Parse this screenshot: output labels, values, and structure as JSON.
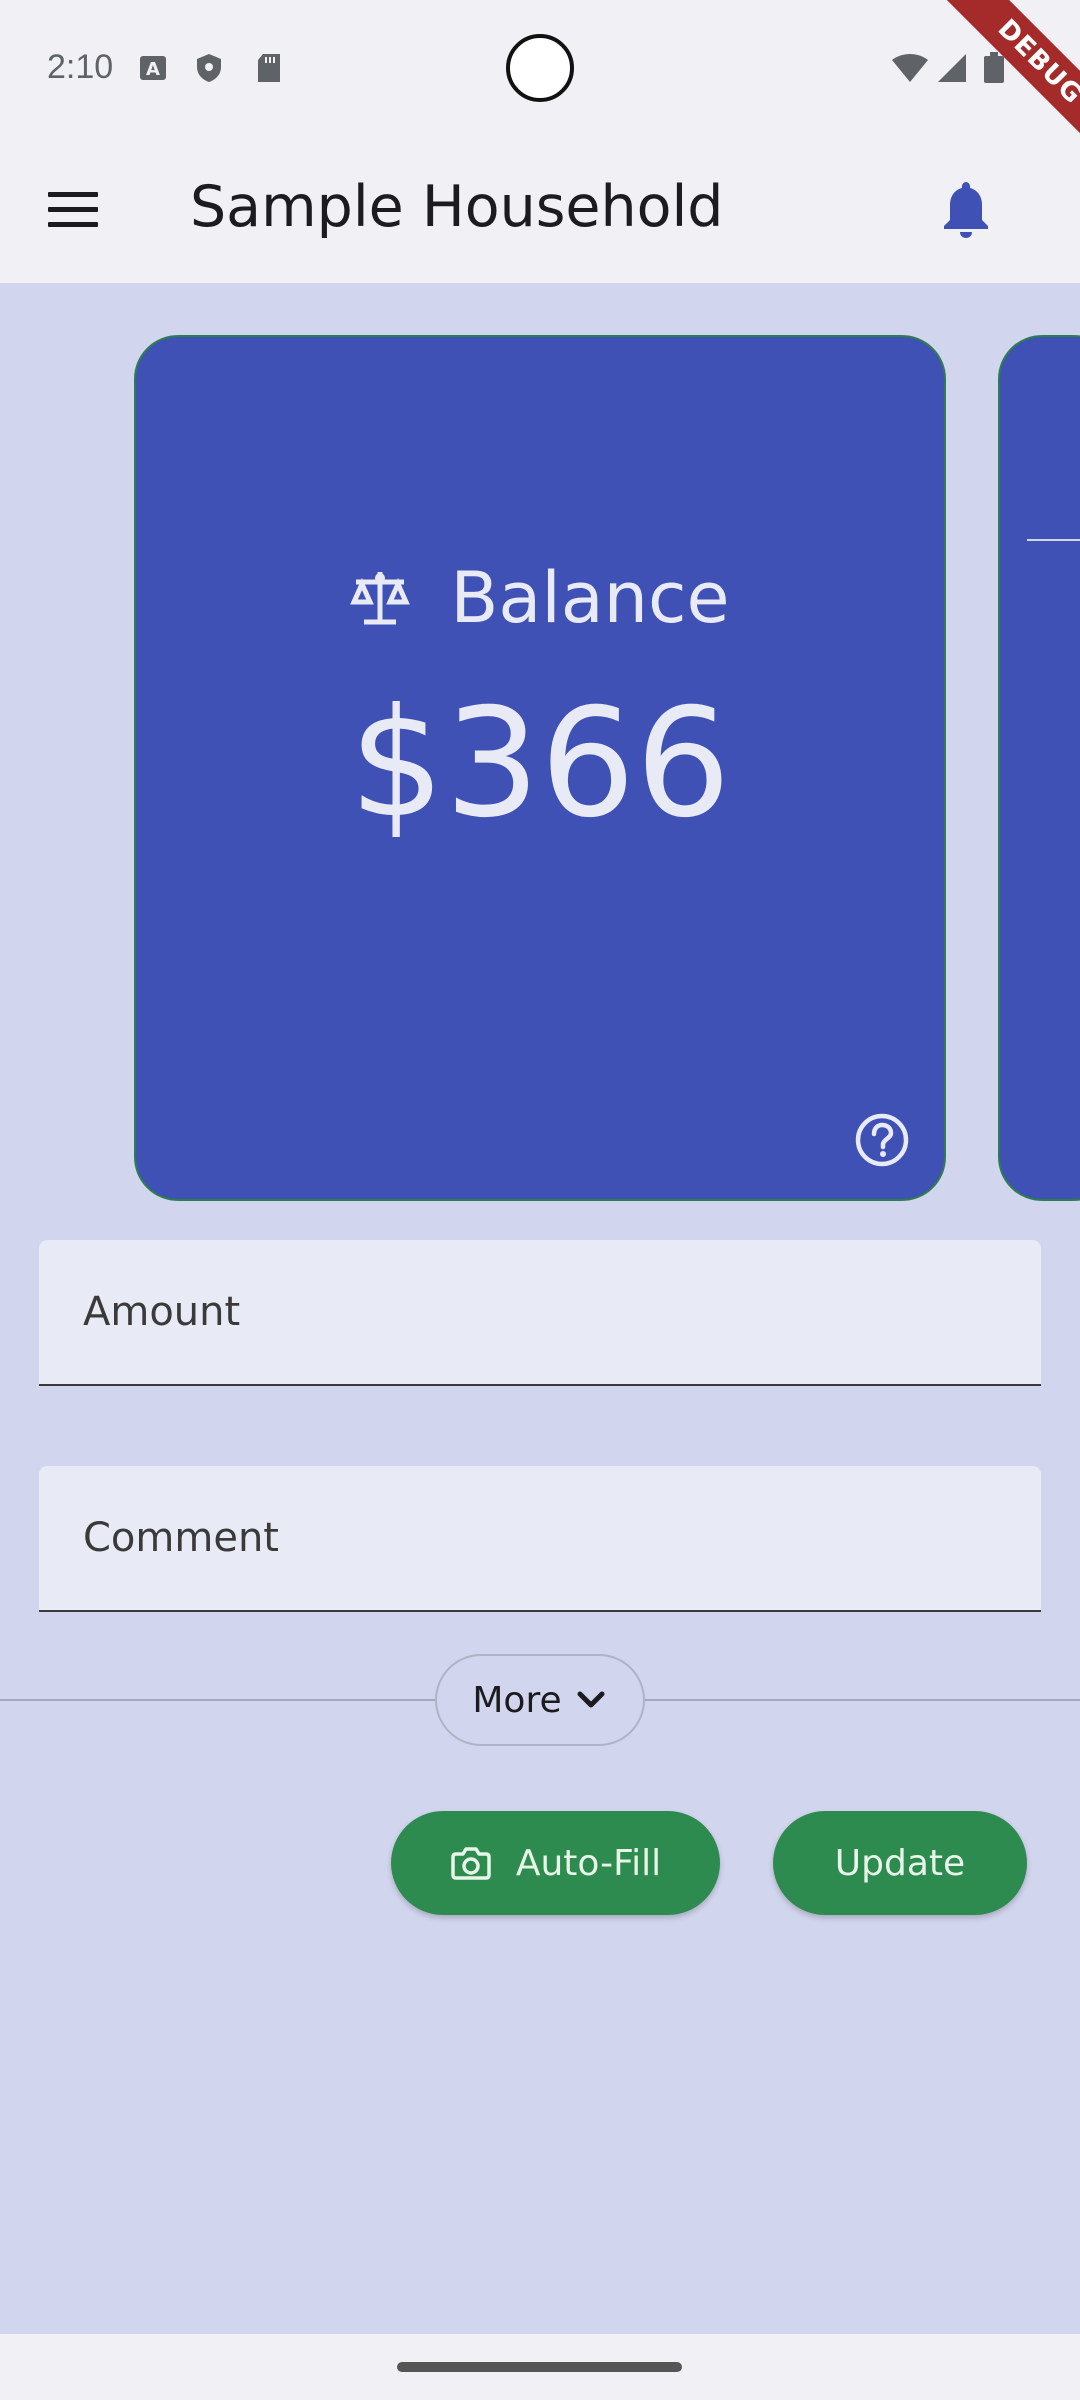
{
  "status_bar": {
    "time": "2:10",
    "icons": [
      "a-icon",
      "shield-icon",
      "sdcard-icon",
      "wifi-icon",
      "signal-icon",
      "battery-icon"
    ]
  },
  "debug_banner": "DEBUG",
  "app_bar": {
    "title": "Sample Household",
    "menu_icon": "hamburger-menu-icon",
    "notification_icon": "bell-icon"
  },
  "balance_card": {
    "label": "Balance",
    "amount": "$366",
    "icon": "scale-icon",
    "help_icon": "help-circle-icon",
    "color": "#3f51b5"
  },
  "form": {
    "amount_placeholder": "Amount",
    "comment_placeholder": "Comment",
    "more_label": "More",
    "autofill_label": "Auto-Fill",
    "update_label": "Update"
  },
  "colors": {
    "background": "#d2d5ee",
    "accent_green": "#2e8b4f",
    "card_blue": "#3f51b5"
  }
}
